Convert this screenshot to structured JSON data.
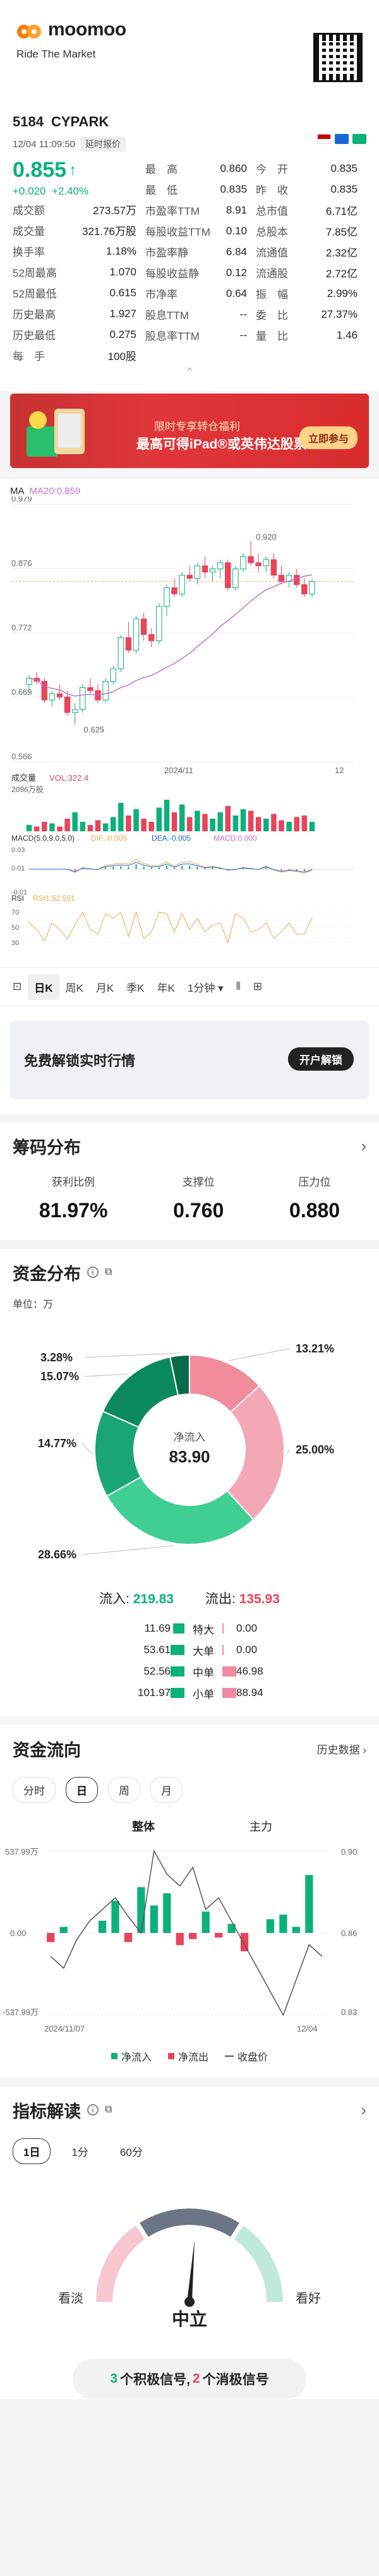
{
  "header": {
    "brand": "moomoo",
    "tagline": "Ride The Market",
    "qr_icon": "qr-code-icon"
  },
  "quote": {
    "code": "5184",
    "name": "CYPARK",
    "time": "12/04 11:09:50",
    "delay_badge": "延时报价",
    "price": "0.855",
    "change": "+0.020",
    "change_pct": "+2.40%",
    "left_col": [
      {
        "k": "成交额",
        "v": "273.57万"
      },
      {
        "k": "成交量",
        "v": "321.76万股"
      },
      {
        "k": "换手率",
        "v": "1.18%"
      },
      {
        "k": "52周最高",
        "v": "1.070"
      },
      {
        "k": "52周最低",
        "v": "0.615"
      },
      {
        "k": "历史最高",
        "v": "1.927"
      },
      {
        "k": "历史最低",
        "v": "0.275"
      },
      {
        "k": "每　手",
        "v": "100股"
      }
    ],
    "mid_col": [
      {
        "k": "最　高",
        "v": "0.860",
        "c": "green"
      },
      {
        "k": "最　低",
        "v": "0.835",
        "c": "red"
      },
      {
        "k": "市盈率TTM",
        "v": "8.91"
      },
      {
        "k": "每股收益TTM",
        "v": "0.10"
      },
      {
        "k": "市盈率静",
        "v": "6.84"
      },
      {
        "k": "每股收益静",
        "v": "0.12"
      },
      {
        "k": "市净率",
        "v": "0.64"
      },
      {
        "k": "股息TTM",
        "v": "--"
      },
      {
        "k": "股息率TTM",
        "v": "--"
      }
    ],
    "right_col": [
      {
        "k": "今　开",
        "v": "0.835"
      },
      {
        "k": "昨　收",
        "v": "0.835"
      },
      {
        "k": "总市值",
        "v": "6.71亿"
      },
      {
        "k": "总股本",
        "v": "7.85亿"
      },
      {
        "k": "流通值",
        "v": "2.32亿"
      },
      {
        "k": "流通股",
        "v": "2.72亿"
      },
      {
        "k": "振　幅",
        "v": "2.99%"
      },
      {
        "k": "委　比",
        "v": "27.37%"
      },
      {
        "k": "量　比",
        "v": "1.46"
      }
    ]
  },
  "banner": {
    "line1": "限时专享转仓福利",
    "line2": "最高可得iPad®或英伟达股票",
    "button": "立即参与"
  },
  "chart": {
    "ma_label": "MA",
    "ma20_label": "MA20:0.859",
    "y_ticks": [
      "0.979",
      "0.876",
      "0.772",
      "0.669",
      "0.566"
    ],
    "high_label": "0.920",
    "low_label": "0.625",
    "x_labels": [
      "2024/11",
      "12"
    ],
    "vol_title": "成交量",
    "vol_label": "VOL:322.4",
    "vol_axis": "2096万股",
    "macd_title": "MACD(5.0,9.0,5.0)",
    "macd_dif": "DIF:-0.005",
    "macd_dea": "DEA:-0.005",
    "macd_val": "MACD:0.000",
    "macd_ticks": [
      "0.03",
      "0.01",
      "-0.01"
    ],
    "rsi_title": "RSI",
    "rsi_val": "RSI1:52.551",
    "rsi_ticks": [
      "70",
      "50",
      "30"
    ],
    "ohlc": [
      [
        0.69,
        0.705,
        0.68,
        0.7
      ],
      [
        0.7,
        0.71,
        0.69,
        0.695
      ],
      [
        0.695,
        0.7,
        0.66,
        0.665
      ],
      [
        0.665,
        0.68,
        0.655,
        0.675
      ],
      [
        0.675,
        0.69,
        0.665,
        0.67
      ],
      [
        0.67,
        0.68,
        0.64,
        0.645
      ],
      [
        0.645,
        0.66,
        0.625,
        0.65
      ],
      [
        0.65,
        0.69,
        0.645,
        0.685
      ],
      [
        0.685,
        0.7,
        0.675,
        0.68
      ],
      [
        0.68,
        0.69,
        0.66,
        0.665
      ],
      [
        0.665,
        0.7,
        0.66,
        0.695
      ],
      [
        0.695,
        0.72,
        0.69,
        0.715
      ],
      [
        0.715,
        0.77,
        0.71,
        0.765
      ],
      [
        0.765,
        0.79,
        0.74,
        0.745
      ],
      [
        0.745,
        0.8,
        0.74,
        0.795
      ],
      [
        0.795,
        0.805,
        0.76,
        0.77
      ],
      [
        0.77,
        0.78,
        0.75,
        0.76
      ],
      [
        0.76,
        0.82,
        0.755,
        0.815
      ],
      [
        0.815,
        0.85,
        0.8,
        0.845
      ],
      [
        0.845,
        0.86,
        0.83,
        0.835
      ],
      [
        0.835,
        0.87,
        0.83,
        0.865
      ],
      [
        0.865,
        0.88,
        0.855,
        0.86
      ],
      [
        0.86,
        0.885,
        0.85,
        0.88
      ],
      [
        0.88,
        0.895,
        0.86,
        0.87
      ],
      [
        0.87,
        0.88,
        0.855,
        0.875
      ],
      [
        0.875,
        0.89,
        0.86,
        0.885
      ],
      [
        0.885,
        0.89,
        0.84,
        0.845
      ],
      [
        0.845,
        0.88,
        0.84,
        0.875
      ],
      [
        0.875,
        0.9,
        0.87,
        0.895
      ],
      [
        0.895,
        0.92,
        0.88,
        0.885
      ],
      [
        0.885,
        0.9,
        0.87,
        0.88
      ],
      [
        0.88,
        0.895,
        0.87,
        0.89
      ],
      [
        0.89,
        0.9,
        0.86,
        0.865
      ],
      [
        0.865,
        0.88,
        0.85,
        0.855
      ],
      [
        0.855,
        0.87,
        0.845,
        0.865
      ],
      [
        0.865,
        0.875,
        0.845,
        0.85
      ],
      [
        0.85,
        0.86,
        0.83,
        0.835
      ],
      [
        0.835,
        0.86,
        0.83,
        0.855
      ]
    ],
    "volumes": [
      4,
      3,
      6,
      5,
      3,
      8,
      12,
      6,
      4,
      7,
      5,
      9,
      18,
      10,
      14,
      8,
      6,
      15,
      20,
      12,
      17,
      9,
      13,
      11,
      8,
      12,
      16,
      10,
      14,
      13,
      9,
      8,
      11,
      7,
      6,
      9,
      10,
      6
    ]
  },
  "period_tabs": [
    "日K",
    "周K",
    "月K",
    "季K",
    "年K",
    "1分钟"
  ],
  "unlock": {
    "title": "免费解锁实时行情",
    "button": "开户解锁"
  },
  "chip": {
    "title": "筹码分布",
    "items": [
      {
        "label": "获利比例",
        "value": "81.97%"
      },
      {
        "label": "支撑位",
        "value": "0.760"
      },
      {
        "label": "压力位",
        "value": "0.880"
      }
    ]
  },
  "fund_dist": {
    "title": "资金分布",
    "unit": "单位：万",
    "center_label": "净流入",
    "center_value": "83.90",
    "slices": [
      {
        "name": "out-large",
        "pct": 13.21,
        "label": "13.21%",
        "color": "#f28b9c"
      },
      {
        "name": "out-small",
        "pct": 25.0,
        "label": "25.00%",
        "color": "#f4a7b5"
      },
      {
        "name": "in-small",
        "pct": 28.66,
        "label": "28.66%",
        "color": "#3fcf93"
      },
      {
        "name": "in-mid",
        "pct": 14.77,
        "label": "14.77%",
        "color": "#1aa574"
      },
      {
        "name": "in-large",
        "pct": 15.07,
        "label": "15.07%",
        "color": "#0b8a5e"
      },
      {
        "name": "in-super",
        "pct": 3.28,
        "label": "3.28%",
        "color": "#066b48"
      }
    ],
    "inflow_label": "流入:",
    "inflow": "219.83",
    "outflow_label": "流出:",
    "outflow": "135.93",
    "rows": [
      {
        "in": "11.69",
        "label": "特大",
        "out": "0.00",
        "inw": 11.69,
        "outw": 0
      },
      {
        "in": "53.61",
        "label": "大单",
        "out": "0.00",
        "inw": 53.61,
        "outw": 0
      },
      {
        "in": "52.56",
        "label": "中单",
        "out": "46.98",
        "inw": 52.56,
        "outw": 46.98
      },
      {
        "in": "101.97",
        "label": "小单",
        "out": "88.94",
        "inw": 101.97,
        "outw": 88.94
      }
    ]
  },
  "fund_flow": {
    "title": "资金流向",
    "history": "历史数据",
    "tabs": [
      "分时",
      "日",
      "周",
      "月"
    ],
    "active_tab": "日",
    "sub_tabs": [
      "整体",
      "主力"
    ],
    "y_left": [
      "537.99万",
      "0.00",
      "-537.99万"
    ],
    "y_right": [
      "0.90",
      "0.86",
      "0.83"
    ],
    "x_left": "2024/11/07",
    "x_right": "12/04",
    "net_in": [
      -60,
      40,
      0,
      0,
      80,
      210,
      -60,
      300,
      180,
      260,
      -80,
      -40,
      140,
      -30,
      60,
      -120,
      0,
      90,
      120,
      40,
      380,
      0
    ],
    "price_line": [
      0.855,
      0.85,
      0.862,
      0.87,
      0.875,
      0.88,
      0.872,
      0.865,
      0.9,
      0.89,
      0.885,
      0.893,
      0.875,
      0.88,
      0.87,
      0.86,
      0.85,
      0.84,
      0.83,
      0.845,
      0.86,
      0.855
    ],
    "legend": [
      "净流入",
      "净流出",
      "收盘价"
    ]
  },
  "indicator": {
    "title": "指标解读",
    "tabs": [
      "1日",
      "1分",
      "60分"
    ],
    "bear": "看淡",
    "bull": "看好",
    "verdict": "中立",
    "pos_count": "3",
    "pos_text": "个积极信号,",
    "neg_count": "2",
    "neg_text": "个消极信号"
  }
}
